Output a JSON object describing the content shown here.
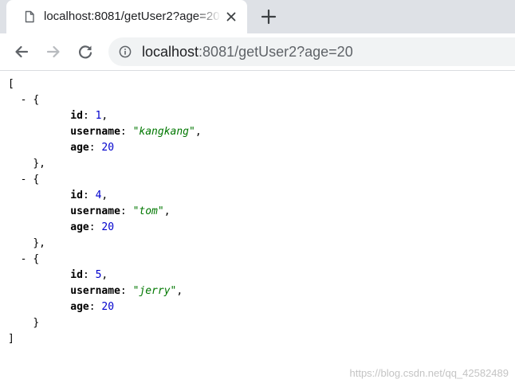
{
  "tab": {
    "title": "localhost:8081/getUser2?age=20",
    "new_tab_label": "+"
  },
  "omnibox": {
    "url_host": "localhost",
    "url_rest": ":8081/getUser2?age=20"
  },
  "json_view": {
    "open_bracket": "[",
    "close_bracket": "]",
    "collapse_glyph": "-",
    "open_brace": "{",
    "close_brace": "}",
    "users": [
      {
        "id": "1",
        "username": "kangkang",
        "age": "20"
      },
      {
        "id": "4",
        "username": "tom",
        "age": "20"
      },
      {
        "id": "5",
        "username": "jerry",
        "age": "20"
      }
    ]
  },
  "watermark": "https://blog.csdn.net/qq_42582489",
  "colors": {
    "tabstrip": "#dee1e6",
    "omnibox": "#f1f3f4",
    "number": "#0000cd",
    "string": "#007700"
  },
  "icons": [
    "page-icon",
    "close-icon",
    "plus-icon",
    "back-arrow-icon",
    "forward-arrow-icon",
    "reload-icon",
    "info-icon"
  ]
}
